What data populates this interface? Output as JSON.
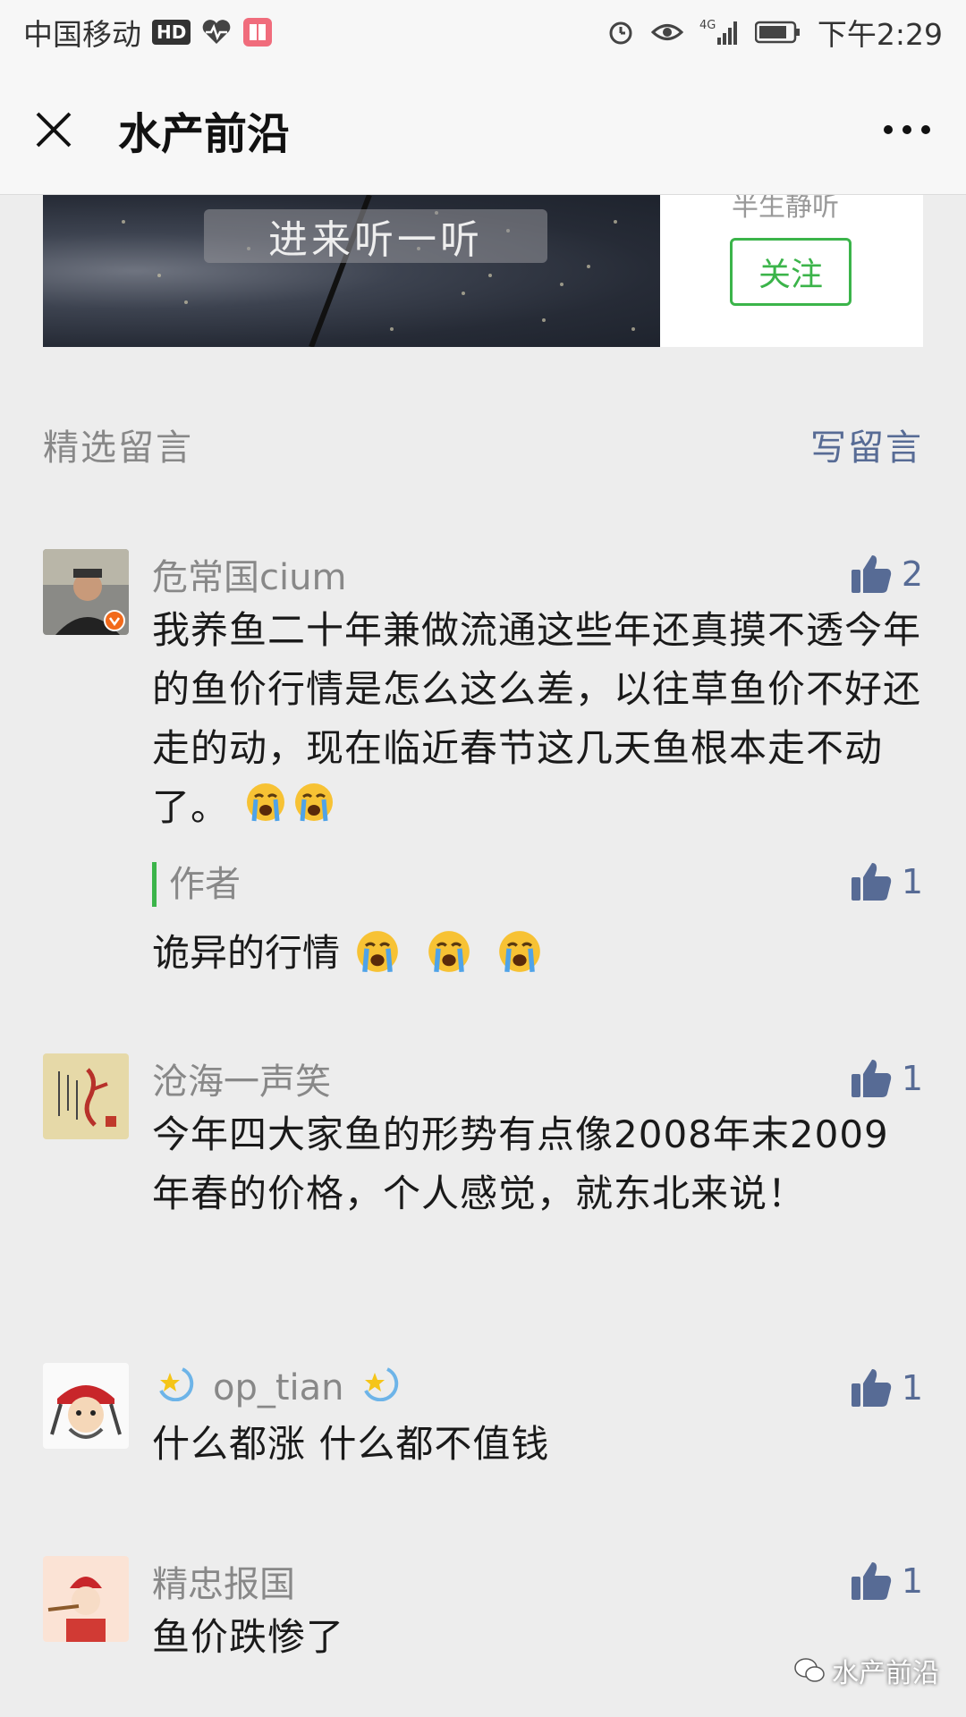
{
  "status_bar": {
    "carrier": "中国移动",
    "hd": "HD",
    "network": "4G",
    "time": "下午2:29"
  },
  "nav": {
    "title": "水产前沿"
  },
  "ad": {
    "caption": "进来听一听",
    "subtitle": "半生静听",
    "follow_label": "关注"
  },
  "section": {
    "title": "精选留言",
    "write_label": "写留言"
  },
  "comments": [
    {
      "name": "危常国cium",
      "likes": "2",
      "text": "我养鱼二十年兼做流通这些年还真摸不透今年的鱼价行情是怎么这么差，以往草鱼价不好还走的动，现在临近春节这几天鱼根本走不动了。",
      "reply": {
        "label": "作者",
        "likes": "1",
        "text": "诡异的行情"
      }
    },
    {
      "name": "沧海一声笑",
      "likes": "1",
      "text": "今年四大家鱼的形势有点像2008年末2009年春的价格，个人感觉，就东北来说！"
    },
    {
      "name": "op_tian",
      "likes": "1",
      "text": "什么都涨 什么都不值钱"
    },
    {
      "name": "精忠报国",
      "likes": "1",
      "text": "鱼价跌惨了"
    }
  ],
  "watermark": {
    "text": "水产前沿"
  },
  "colors": {
    "link": "#576b95",
    "accent_green": "#3bb44a",
    "background": "#ededed"
  }
}
